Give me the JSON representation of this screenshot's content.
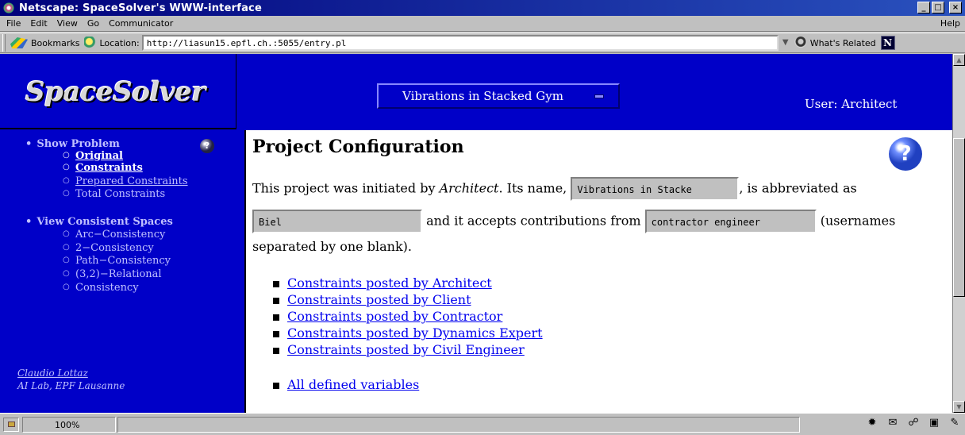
{
  "window": {
    "title": "Netscape: SpaceSolver's WWW-interface",
    "min_glyph": "_",
    "max_glyph": "□",
    "close_glyph": "×"
  },
  "menu": {
    "items": [
      "File",
      "Edit",
      "View",
      "Go",
      "Communicator"
    ],
    "help": "Help"
  },
  "location_bar": {
    "bookmarks_label": "Bookmarks",
    "location_label": "Location:",
    "url": "http://liasun15.epfl.ch.:5055/entry.pl",
    "related_label": "What's Related",
    "n_logo": "N"
  },
  "header": {
    "logo_text": "SpaceSolver",
    "topic_selected": "Vibrations in Stacked Gym",
    "user_label": "User: Architect"
  },
  "nav": {
    "help_glyph": "?",
    "show_problem": "Show Problem",
    "original_line1": "Original",
    "original_line2": "Constraints",
    "prepared": "Prepared Constraints",
    "total": "Total Constraints",
    "view_spaces": "View Consistent Spaces",
    "arc": "Arc−Consistency",
    "two": "2−Consistency",
    "path": "Path−Consistency",
    "relational_line1": "(3,2)−Relational",
    "relational_line2": "Consistency",
    "author": "Claudio Lottaz",
    "lab": "AI Lab, EPF Lausanne"
  },
  "content": {
    "heading": "Project Configuration",
    "help_glyph": "?",
    "text1": "This project was initiated by ",
    "initiator": "Architect",
    "text2": ". Its name, ",
    "name_field": "Vibrations in Stacke",
    "text3": ", is abbreviated as",
    "abbrev_field": "Biel",
    "text4": " and it accepts contributions from ",
    "contrib_field": "contractor engineer",
    "text5": " (usernames",
    "text6": "separated by one blank).",
    "links": [
      "Constraints posted by Architect",
      "Constraints posted by Client",
      "Constraints posted by Contractor",
      "Constraints posted by Dynamics Expert",
      "Constraints posted by Civil Engineer"
    ],
    "all_vars": "All defined variables"
  },
  "status": {
    "zoom": "100%"
  },
  "colors": {
    "page_blue": "#0000c8",
    "link": "#0000ee",
    "chrome_gray": "#c0c0c0"
  }
}
